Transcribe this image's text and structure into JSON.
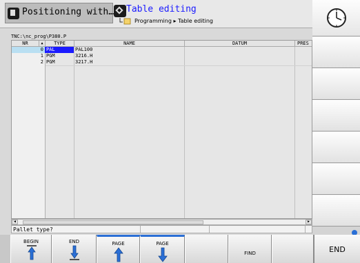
{
  "header": {
    "mode_left": "Positioning with…",
    "mode_right_title": "Table editing",
    "breadcrumb": "Programming ▸ Table editing"
  },
  "table": {
    "path": "TNC:\\nc_prog\\P380.P",
    "columns": [
      "NR",
      "TYPE",
      "NAME",
      "DATUM",
      "PRES"
    ],
    "rows": [
      {
        "nr": "0",
        "type": "PAL",
        "name": "PAL100"
      },
      {
        "nr": "1",
        "type": "PGM",
        "name": "3216.H"
      },
      {
        "nr": "2",
        "type": "PGM",
        "name": "3217.H"
      }
    ]
  },
  "status": {
    "message": "Pallet type?"
  },
  "softkeys": {
    "begin": "BEGIN",
    "end": "END",
    "page_up": "PAGE",
    "page_down": "PAGE",
    "find": "FIND",
    "end_big": "END"
  },
  "colors": {
    "selection": "#1a1aff",
    "accent": "#2a6fd6",
    "row_highlight": "#b9dff2"
  }
}
